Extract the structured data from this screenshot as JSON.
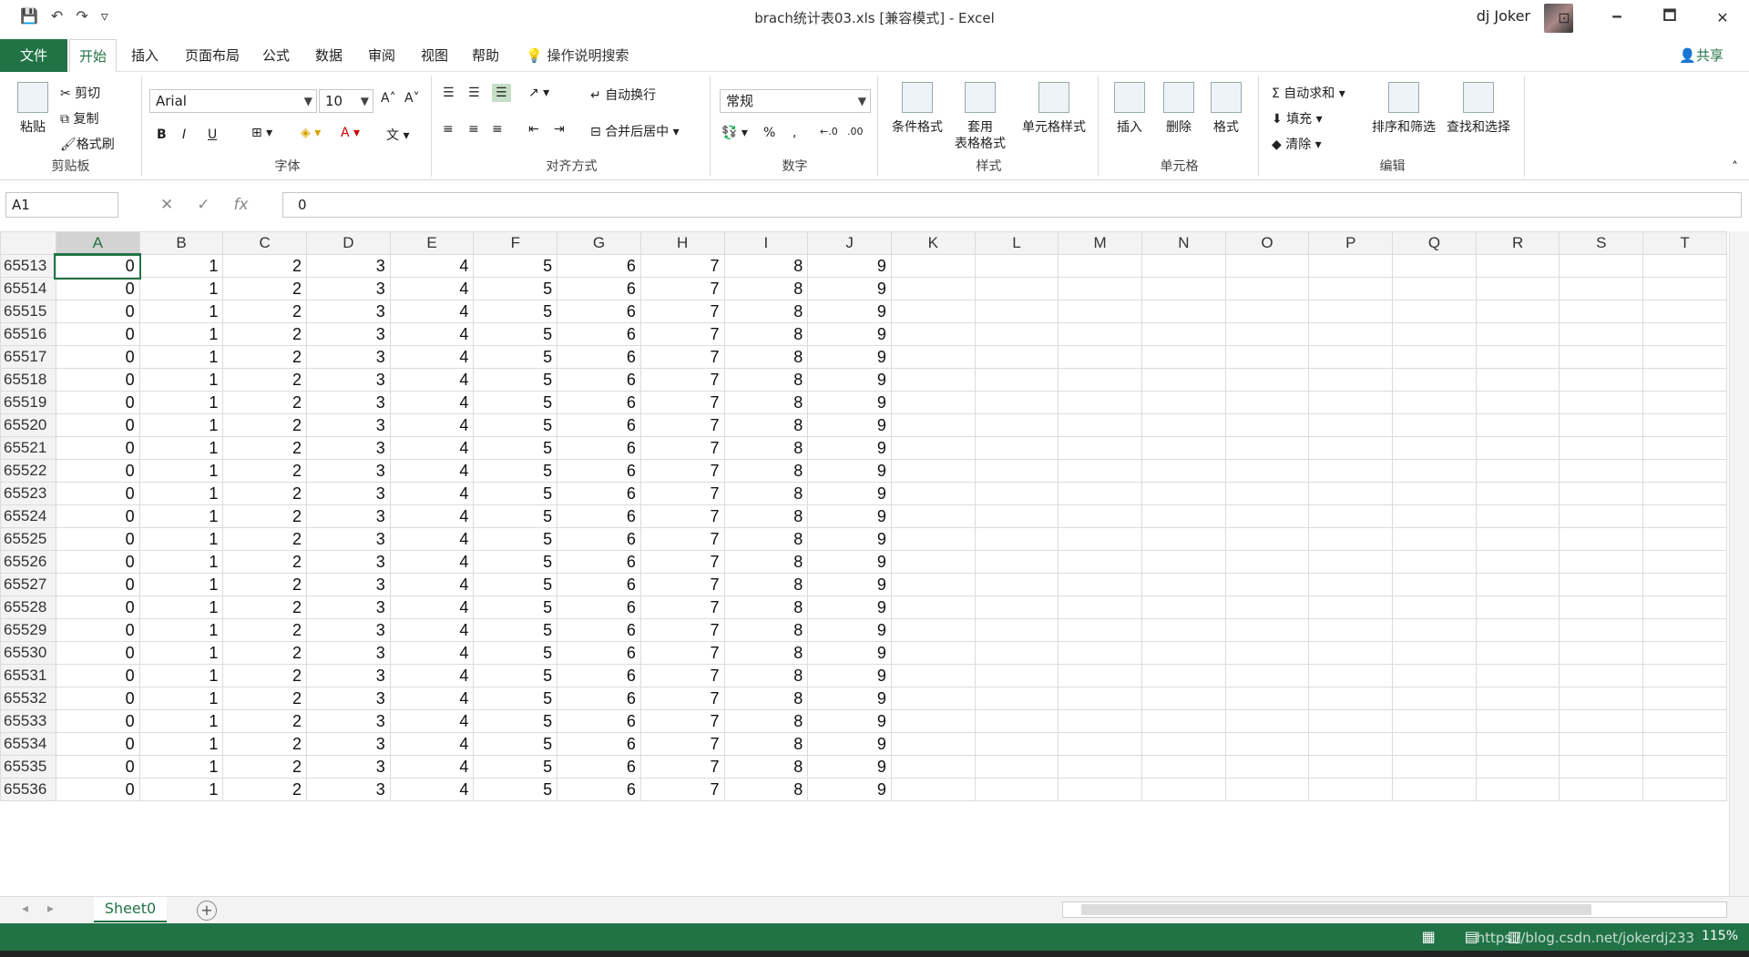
{
  "window": {
    "title": "brach统计表03.xls  [兼容模式]  -  Excel",
    "user": "dj Joker",
    "controls": [
      "🗕",
      "🗖",
      "✕"
    ]
  },
  "qat": {
    "save": "💾",
    "undo": "↶",
    "redo": "↷",
    "customize": "▿"
  },
  "tabs": [
    "文件",
    "开始",
    "插入",
    "页面布局",
    "公式",
    "数据",
    "审阅",
    "视图",
    "帮助"
  ],
  "tell_me": "操作说明搜索",
  "share": "共享",
  "ribbon": {
    "clipboard": {
      "paste": "粘贴",
      "cut": "剪切",
      "copy": "复制",
      "format_painter": "格式刷",
      "label": "剪贴板"
    },
    "font": {
      "name": "Arial",
      "size": "10",
      "bold": "B",
      "italic": "I",
      "underline": "U",
      "label": "字体"
    },
    "alignment": {
      "wrap": "自动换行",
      "merge": "合并后居中",
      "label": "对齐方式"
    },
    "number": {
      "format": "常规",
      "percent": "%",
      "comma": ",",
      "label": "数字"
    },
    "styles": {
      "conditional": "条件格式",
      "table_fmt_1": "套用",
      "table_fmt_2": "表格格式",
      "cell_styles": "单元格样式",
      "label": "样式"
    },
    "cells": {
      "insert": "插入",
      "delete": "删除",
      "format": "格式",
      "label": "单元格"
    },
    "editing": {
      "autosum": "自动求和",
      "fill": "填充",
      "clear": "清除",
      "sort": "排序和筛选",
      "find": "查找和选择",
      "label": "编辑"
    }
  },
  "formula_bar": {
    "name_box": "A1",
    "fx": "fx",
    "value": "0"
  },
  "sheet": {
    "columns": [
      "A",
      "B",
      "C",
      "D",
      "E",
      "F",
      "G",
      "H",
      "I",
      "J",
      "K",
      "L",
      "M",
      "N",
      "O",
      "P",
      "Q",
      "R",
      "S",
      "T"
    ],
    "selected_column": "A",
    "row_numbers": [
      "65513",
      "65514",
      "65515",
      "65516",
      "65517",
      "65518",
      "65519",
      "65520",
      "65521",
      "65522",
      "65523",
      "65524",
      "65525",
      "65526",
      "65527",
      "65528",
      "65529",
      "65530",
      "65531",
      "65532",
      "65533",
      "65534",
      "65535",
      "65536"
    ],
    "row_values": [
      "0",
      "1",
      "2",
      "3",
      "4",
      "5",
      "6",
      "7",
      "8",
      "9"
    ]
  },
  "sheet_tab": "Sheet0",
  "status": {
    "zoom": "115%",
    "watermark": "https://blog.csdn.net/jokerdj233"
  }
}
